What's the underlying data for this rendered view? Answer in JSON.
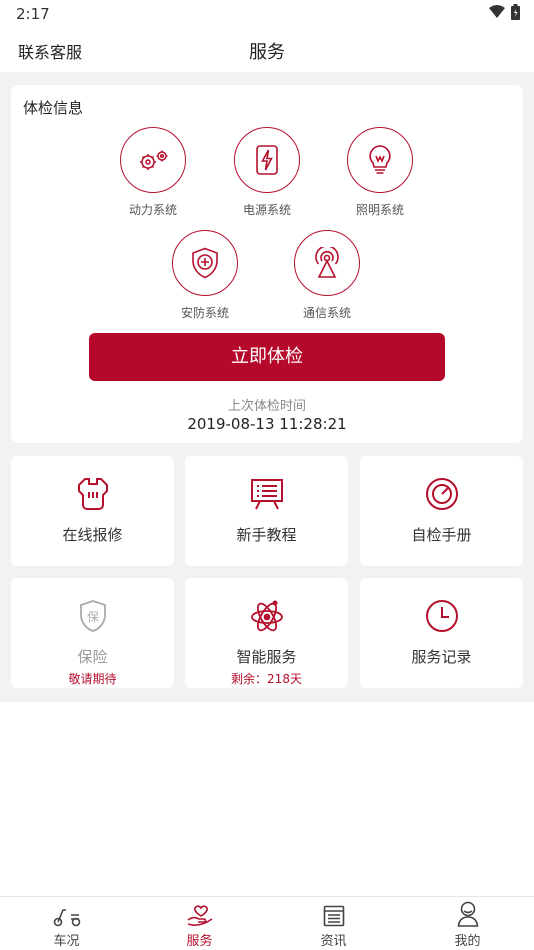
{
  "status": {
    "time": "2:17"
  },
  "header": {
    "left_link": "联系客服",
    "title": "服务"
  },
  "exam": {
    "title": "体检信息",
    "systems": [
      {
        "label": "动力系统",
        "icon": "gears-icon"
      },
      {
        "label": "电源系统",
        "icon": "battery-icon"
      },
      {
        "label": "照明系统",
        "icon": "bulb-icon"
      },
      {
        "label": "安防系统",
        "icon": "shield-icon"
      },
      {
        "label": "通信系统",
        "icon": "signal-tower-icon"
      }
    ],
    "button": "立即体检",
    "last_label": "上次体检时间",
    "last_time": "2019-08-13 11:28:21"
  },
  "services": [
    {
      "label": "在线报修",
      "icon": "repair-icon"
    },
    {
      "label": "新手教程",
      "icon": "tutorial-board-icon"
    },
    {
      "label": "自检手册",
      "icon": "gauge-icon"
    },
    {
      "label": "保险",
      "sub": "敬请期待",
      "icon": "insurance-shield-icon"
    },
    {
      "label": "智能服务",
      "sub": "剩余：218天",
      "icon": "atom-icon"
    },
    {
      "label": "服务记录",
      "icon": "clock-icon"
    }
  ],
  "tabs": [
    {
      "label": "车况",
      "icon": "scooter-icon"
    },
    {
      "label": "服务",
      "icon": "hand-heart-icon",
      "active": true
    },
    {
      "label": "资讯",
      "icon": "news-icon"
    },
    {
      "label": "我的",
      "icon": "user-icon"
    }
  ],
  "colors": {
    "accent": "#b5102d",
    "button": "#b5082a",
    "background": "#f2f2f2"
  }
}
